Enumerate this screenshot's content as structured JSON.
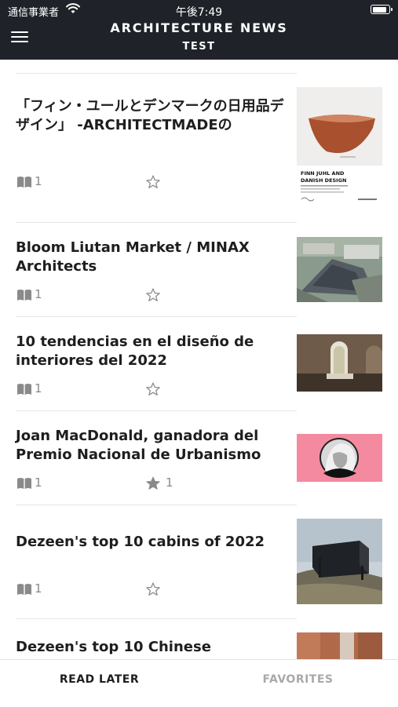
{
  "status_bar": {
    "carrier": "通信事業者",
    "time": "午後7:49"
  },
  "header": {
    "title": "ARCHITECTURE NEWS",
    "subtitle": "TEST"
  },
  "articles": [
    {
      "title": "「フィン・ユールとデンマークの日用品デザイン」 -ARCHITECTMADEの",
      "read_count": "1",
      "favorited": false,
      "favorite_count": "",
      "thumb_caption": "FINN JUHL AND DANISH DESIGN"
    },
    {
      "title": "Bloom Liutan Market / MINAX Architects",
      "read_count": "1",
      "favorited": false,
      "favorite_count": ""
    },
    {
      "title": "10 tendencias en el diseño de interiores del 2022",
      "read_count": "1",
      "favorited": false,
      "favorite_count": ""
    },
    {
      "title": "Joan MacDonald, ganadora del Premio Nacional de Urbanismo",
      "read_count": "1",
      "favorited": true,
      "favorite_count": "1"
    },
    {
      "title": "Dezeen's top 10 cabins of 2022",
      "read_count": "1",
      "favorited": false,
      "favorite_count": ""
    },
    {
      "title": "Dezeen's top 10 Chinese",
      "read_count": "",
      "favorited": false,
      "favorite_count": ""
    }
  ],
  "tabs": {
    "read_later": "READ LATER",
    "favorites": "FAVORITES"
  },
  "colors": {
    "header_bg": "#1f2329",
    "tab_active": "#1e1e1e",
    "tab_inactive": "#a9a9a9",
    "icon_gray": "#8a8a8a"
  }
}
